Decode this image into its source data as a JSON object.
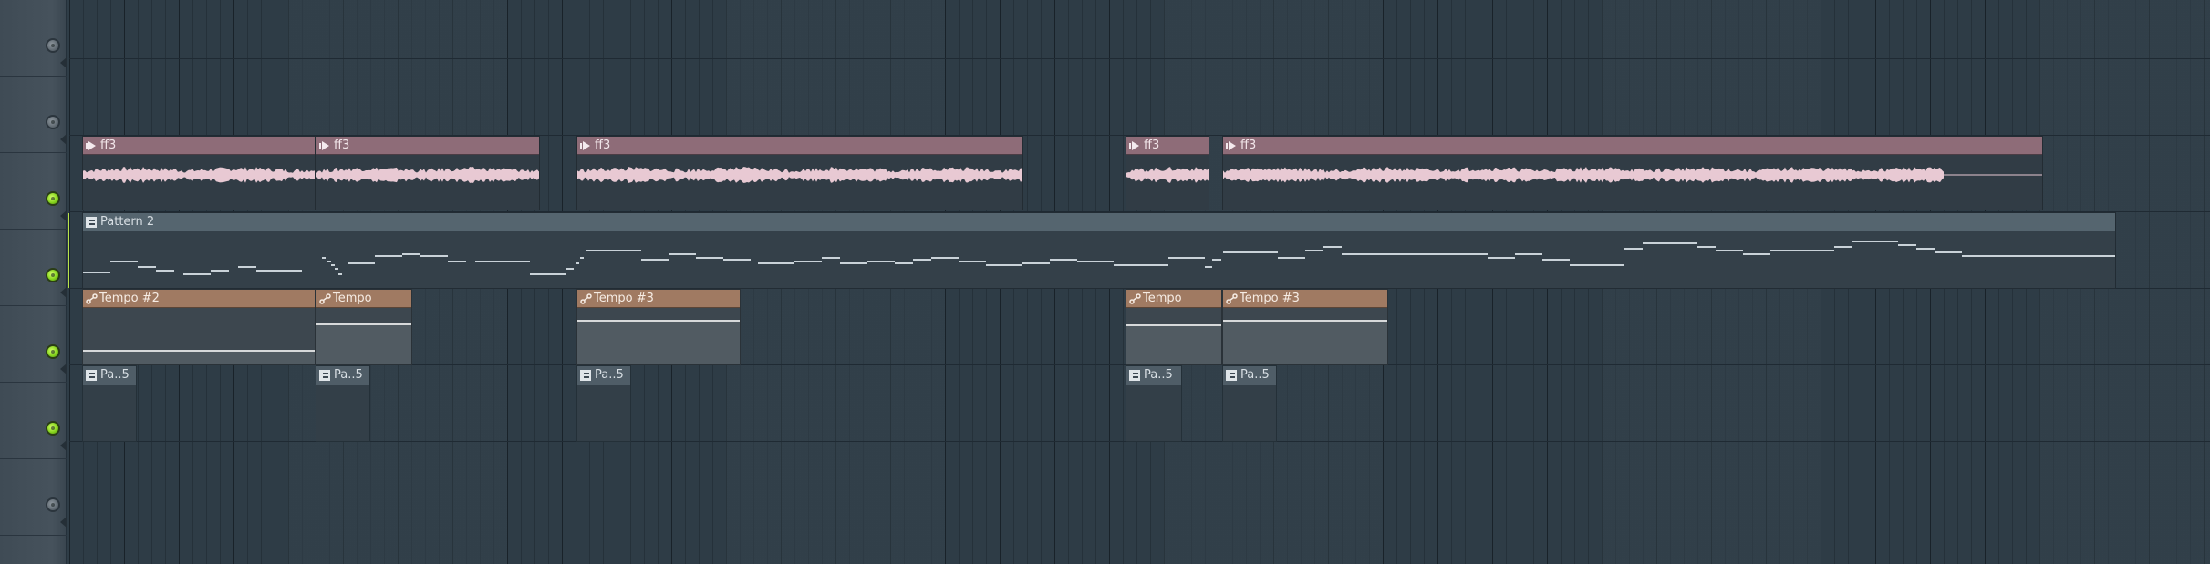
{
  "tracks": [
    {
      "index": 1,
      "led": "off"
    },
    {
      "index": 2,
      "led": "off"
    },
    {
      "index": 3,
      "led": "on"
    },
    {
      "index": 4,
      "led": "on"
    },
    {
      "index": 5,
      "led": "on"
    },
    {
      "index": 6,
      "led": "on"
    },
    {
      "index": 7,
      "led": "off"
    }
  ],
  "audio_clips": [
    {
      "label": "ff3"
    },
    {
      "label": "ff3"
    },
    {
      "label": "ff3"
    },
    {
      "label": "ff3"
    },
    {
      "label": "ff3"
    }
  ],
  "pattern_clip": {
    "label": "Pattern 2"
  },
  "automation_clips": [
    {
      "label": "Tempo #2"
    },
    {
      "label": "Tempo"
    },
    {
      "label": "Tempo #3"
    },
    {
      "label": "Tempo"
    },
    {
      "label": "Tempo #3"
    }
  ],
  "small_pattern_clips": [
    {
      "label": "Pa..5"
    },
    {
      "label": "Pa..5"
    },
    {
      "label": "Pa..5"
    },
    {
      "label": "Pa..5"
    },
    {
      "label": "Pa..5"
    }
  ],
  "colors": {
    "audio_clip": "#8e6c78",
    "pattern_clip": "#55656f",
    "automation_clip": "#a07a62",
    "led_on": "#86d41e",
    "led_off": "#5a646c"
  }
}
